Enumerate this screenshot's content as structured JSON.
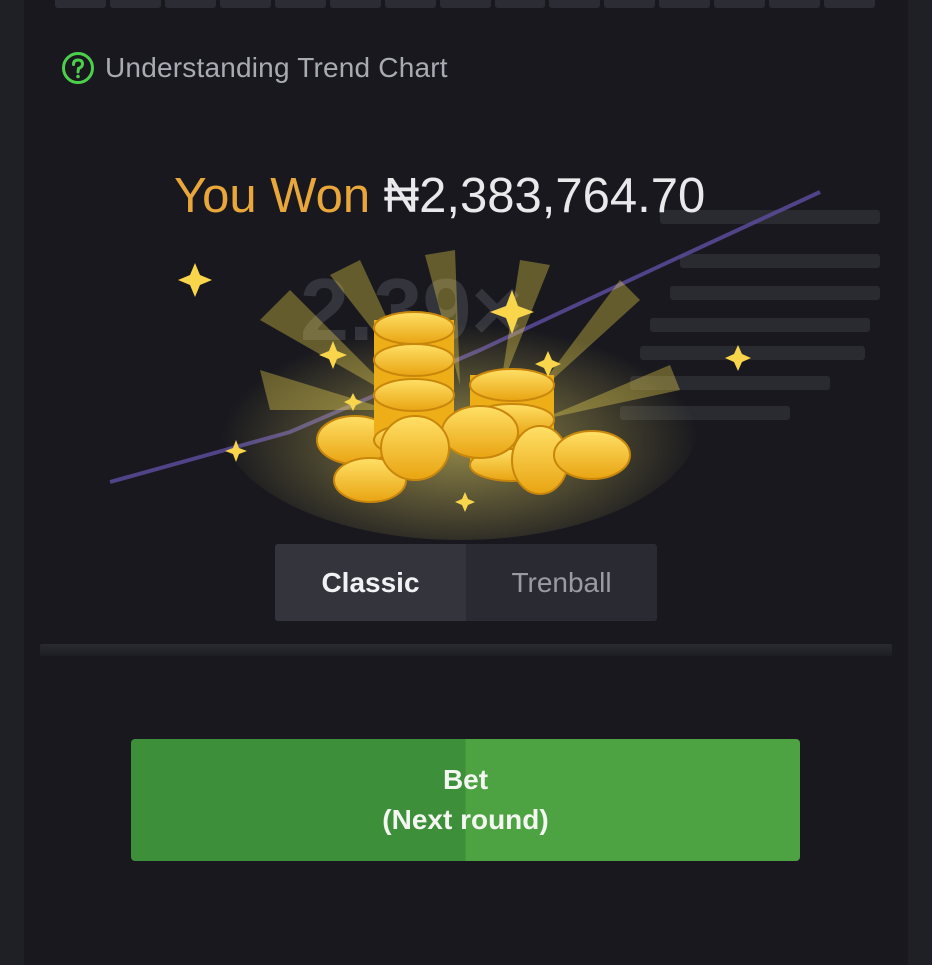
{
  "help": {
    "label": "Understanding Trend Chart",
    "icon": "question-circle-icon"
  },
  "result": {
    "label": "You Won",
    "amount": "₦2,383,764.70",
    "multiplier": "2.39×"
  },
  "mode_toggle": {
    "tabs": [
      {
        "label": "Classic",
        "active": true
      },
      {
        "label": "Trenball",
        "active": false
      }
    ]
  },
  "bet_button": {
    "line1": "Bet",
    "line2": "(Next round)"
  },
  "colors": {
    "background": "#18181e",
    "won_label": "#e9a63a",
    "help_icon": "#4ccf4a",
    "bet_green": "#4da242",
    "coin_gold": "#f3c21c"
  }
}
